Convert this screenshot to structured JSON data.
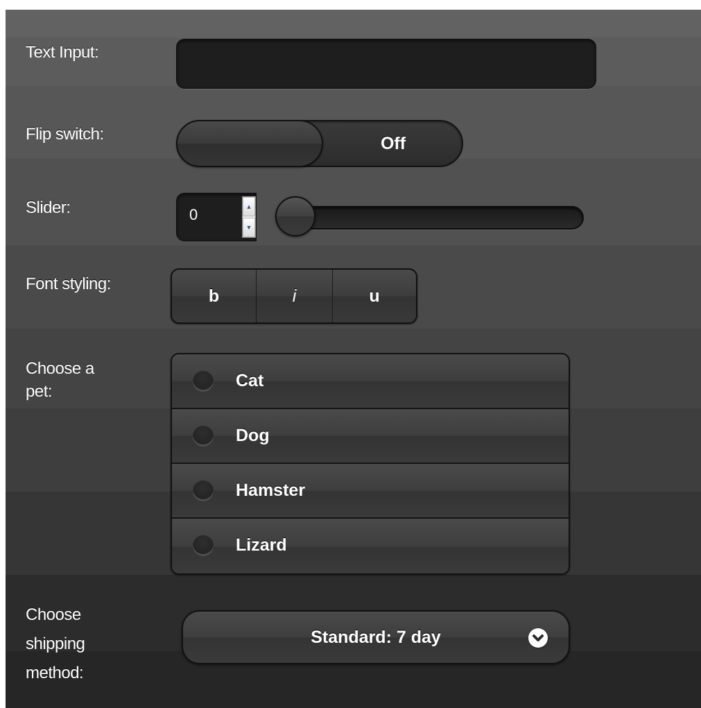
{
  "form": {
    "text_input": {
      "label": "Text Input:",
      "value": "",
      "placeholder": ""
    },
    "flip_switch": {
      "label": "Flip switch:",
      "state_label": "Off"
    },
    "slider": {
      "label": "Slider:",
      "value": "0"
    },
    "font_styling": {
      "label": "Font styling:",
      "buttons": [
        "b",
        "i",
        "u"
      ]
    },
    "pet": {
      "label_line1": "Choose a",
      "label_line2": "pet:",
      "options": [
        "Cat",
        "Dog",
        "Hamster",
        "Lizard"
      ]
    },
    "shipping": {
      "label_line1": "Choose",
      "label_line2": "shipping",
      "label_line3": "method:",
      "selected": "Standard: 7 day"
    }
  },
  "icons": {
    "spinner_up": "spin-up-icon",
    "spinner_down": "spin-down-icon",
    "radio": "radio-unchecked-icon",
    "select_chevron": "chevron-down-icon"
  },
  "colors": {
    "text": "#ffffff",
    "input_bg": "#1e1e1e",
    "button_bg": "#3e3e3e",
    "spinner_arrow": "#3a5a8a"
  }
}
